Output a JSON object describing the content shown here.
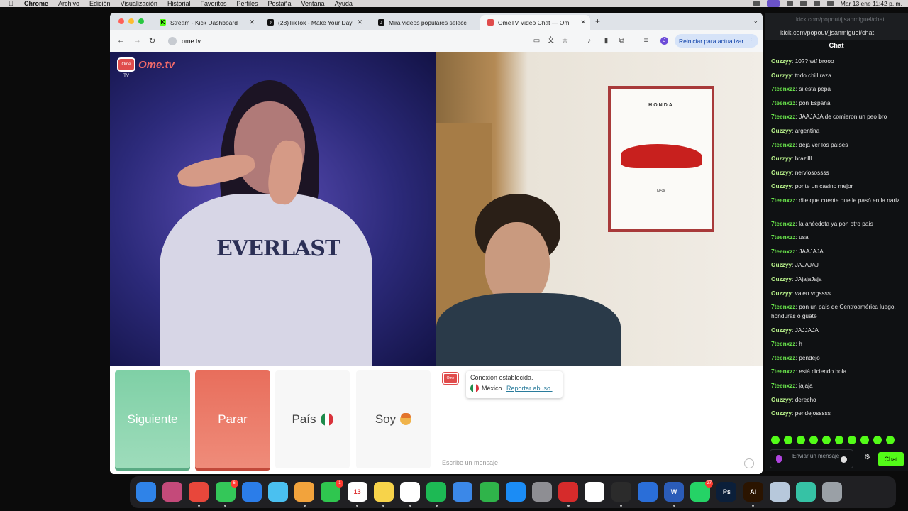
{
  "menubar": {
    "app": "Chrome",
    "items": [
      "Archivo",
      "Edición",
      "Visualización",
      "Historial",
      "Favoritos",
      "Perfiles",
      "Pestaña",
      "Ventana",
      "Ayuda"
    ],
    "clock": "Mar 13 ene  11:42 p. m."
  },
  "browser": {
    "tabs": [
      {
        "label": "Stream - Kick Dashboard",
        "icon": "kick-icon"
      },
      {
        "label": "(28)TikTok - Make Your Day",
        "icon": "tiktok-icon"
      },
      {
        "label": "Mira videos populares selecci",
        "icon": "tiktok-icon"
      },
      {
        "label": "OmeTV Video Chat — Om",
        "icon": "ometv-icon"
      }
    ],
    "url": "ome.tv",
    "relaunch_label": "Reiniciar para actualizar",
    "profile_initial": "J"
  },
  "ometv": {
    "logo_text": "Ome.tv",
    "logo_badge": "Ome TV",
    "poster_brand": "HONDA",
    "poster_model": "NSX",
    "buttons": {
      "next": "Siguiente",
      "stop": "Parar",
      "country": "País",
      "gender": "Soy"
    },
    "status": {
      "connected": "Conexión establecida.",
      "country": "México.",
      "report": "Reportar abuso."
    },
    "message_placeholder": "Escribe un mensaje"
  },
  "kick": {
    "window_title": "kick.com/popout/jjsanmiguel/chat",
    "url": "kick.com/popout/jjsanmiguel/chat",
    "header": "Chat",
    "messages": [
      {
        "user": "Ouzzyy",
        "text": "10?? wtf brooo"
      },
      {
        "user": "Ouzzyy",
        "text": "todo chill raza"
      },
      {
        "user": "7teenxzz",
        "text": "si está pepa"
      },
      {
        "user": "7teenxzz",
        "text": "pon España"
      },
      {
        "user": "7teenxzz",
        "text": "JAAJAJA de comieron un peo bro"
      },
      {
        "user": "Ouzzyy",
        "text": "argentina"
      },
      {
        "user": "7teenxzz",
        "text": "deja ver los países"
      },
      {
        "user": "Ouzzyy",
        "text": "brazilll"
      },
      {
        "user": "Ouzzyy",
        "text": "nerviosossss"
      },
      {
        "user": "Ouzzyy",
        "text": "ponte un casino mejor"
      },
      {
        "user": "7teenxzz",
        "text": "dile que cuente que le pasó en la nariz"
      },
      {
        "user": "7teenxzz",
        "text": "la anécdota ya pon otro país"
      },
      {
        "user": "7teenxzz",
        "text": "usa"
      },
      {
        "user": "7teenxzz",
        "text": "JAAJAJA"
      },
      {
        "user": "Ouzzyy",
        "text": "JAJAJAJ"
      },
      {
        "user": "Ouzzyy",
        "text": "JAjajaJaja"
      },
      {
        "user": "Ouzzyy",
        "text": "valen vrgssss"
      },
      {
        "user": "7teenxzz",
        "text": "pon un país de Centroamérica luego, honduras o guate"
      },
      {
        "user": "Ouzzyy",
        "text": "JAJJAJA"
      },
      {
        "user": "7teenxzz",
        "text": "h"
      },
      {
        "user": "7teenxzz",
        "text": "pendejo"
      },
      {
        "user": "7teenxzz",
        "text": "está diciendo hola"
      },
      {
        "user": "7teenxzz",
        "text": "jajaja"
      },
      {
        "user": "Ouzzyy",
        "text": "derecho"
      },
      {
        "user": "Ouzzyy",
        "text": "pendejosssss"
      }
    ],
    "input_placeholder": "Enviar un mensaje",
    "send_label": "Chat"
  },
  "dock": {
    "apps": [
      {
        "name": "finder-icon",
        "color": "#2f83e8",
        "label": ""
      },
      {
        "name": "launchpad-icon",
        "color": "#c44a7a",
        "label": ""
      },
      {
        "name": "chrome-icon",
        "color": "#e8473b",
        "label": ""
      },
      {
        "name": "messages-icon",
        "color": "#34c759",
        "label": "",
        "badge": "6"
      },
      {
        "name": "mail-icon",
        "color": "#2b7de9",
        "label": ""
      },
      {
        "name": "maps-icon",
        "color": "#4ac0f0",
        "label": ""
      },
      {
        "name": "photos-icon",
        "color": "#f2a33c",
        "label": ""
      },
      {
        "name": "facetime-icon",
        "color": "#2fc64f",
        "label": "",
        "badge": "1"
      },
      {
        "name": "calendar-icon",
        "color": "#ffffff",
        "label": "13"
      },
      {
        "name": "notes-icon",
        "color": "#f7d34a",
        "label": ""
      },
      {
        "name": "freeform-icon",
        "color": "#ffffff",
        "label": ""
      },
      {
        "name": "spotify-icon",
        "color": "#1db954",
        "label": ""
      },
      {
        "name": "keynote-icon",
        "color": "#3b88e8",
        "label": ""
      },
      {
        "name": "numbers-icon",
        "color": "#2fb44a",
        "label": ""
      },
      {
        "name": "appstore-icon",
        "color": "#1b8cf5",
        "label": ""
      },
      {
        "name": "settings-icon",
        "color": "#8e8e93",
        "label": ""
      },
      {
        "name": "photobooth-icon",
        "color": "#d62b2b",
        "label": ""
      },
      {
        "name": "capcut-icon",
        "color": "#ffffff",
        "label": ""
      },
      {
        "name": "obs-icon",
        "color": "#2b2b2b",
        "label": ""
      },
      {
        "name": "xcode-sim-icon",
        "color": "#2a6ed8",
        "label": ""
      },
      {
        "name": "word-icon",
        "color": "#2b5cb8",
        "label": "W"
      },
      {
        "name": "whatsapp-icon",
        "color": "#25d366",
        "label": "",
        "badge": "27"
      },
      {
        "name": "photoshop-icon",
        "color": "#0b1f3a",
        "label": "Ps"
      },
      {
        "name": "illustrator-icon",
        "color": "#2b1400",
        "label": "Ai"
      },
      {
        "name": "preview-icon",
        "color": "#b7c8db",
        "label": ""
      },
      {
        "name": "robinhood-icon",
        "color": "#36c2a5",
        "label": ""
      },
      {
        "name": "trash-icon",
        "color": "#9aa0a6",
        "label": ""
      }
    ]
  },
  "colors": {
    "kick_green": "#53fc18",
    "next_green": "#7fd0a6",
    "stop_red": "#e86e5c"
  }
}
